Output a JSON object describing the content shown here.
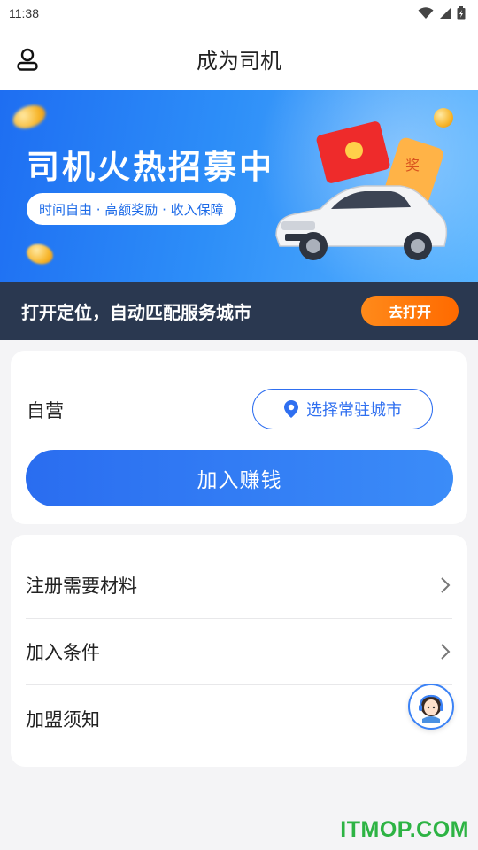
{
  "status_bar": {
    "time": "11:38",
    "icons": [
      "wifi-icon",
      "signal-icon",
      "battery-icon"
    ]
  },
  "header": {
    "title": "成为司机",
    "user_icon": "user-icon"
  },
  "banner": {
    "title": "司机火热招募中",
    "subtitle": "时间自由 · 高额奖励 · 收入保障",
    "envelope_char": "奖"
  },
  "location_bar": {
    "text": "打开定位，自动匹配服务城市",
    "button": "去打开"
  },
  "join_card": {
    "label": "自营",
    "city_button": "选择常驻城市",
    "join_button": "加入赚钱"
  },
  "info_list": {
    "items": [
      {
        "label": "注册需要材料"
      },
      {
        "label": "加入条件"
      },
      {
        "label": "加盟须知"
      }
    ]
  },
  "customer_service": {
    "icon": "customer-service-icon"
  },
  "watermark": "ITMOP.COM",
  "colors": {
    "primary": "#2f6ff0",
    "accent": "#ff7a0d",
    "dark_bar": "#2a3850",
    "watermark": "#2db344"
  }
}
